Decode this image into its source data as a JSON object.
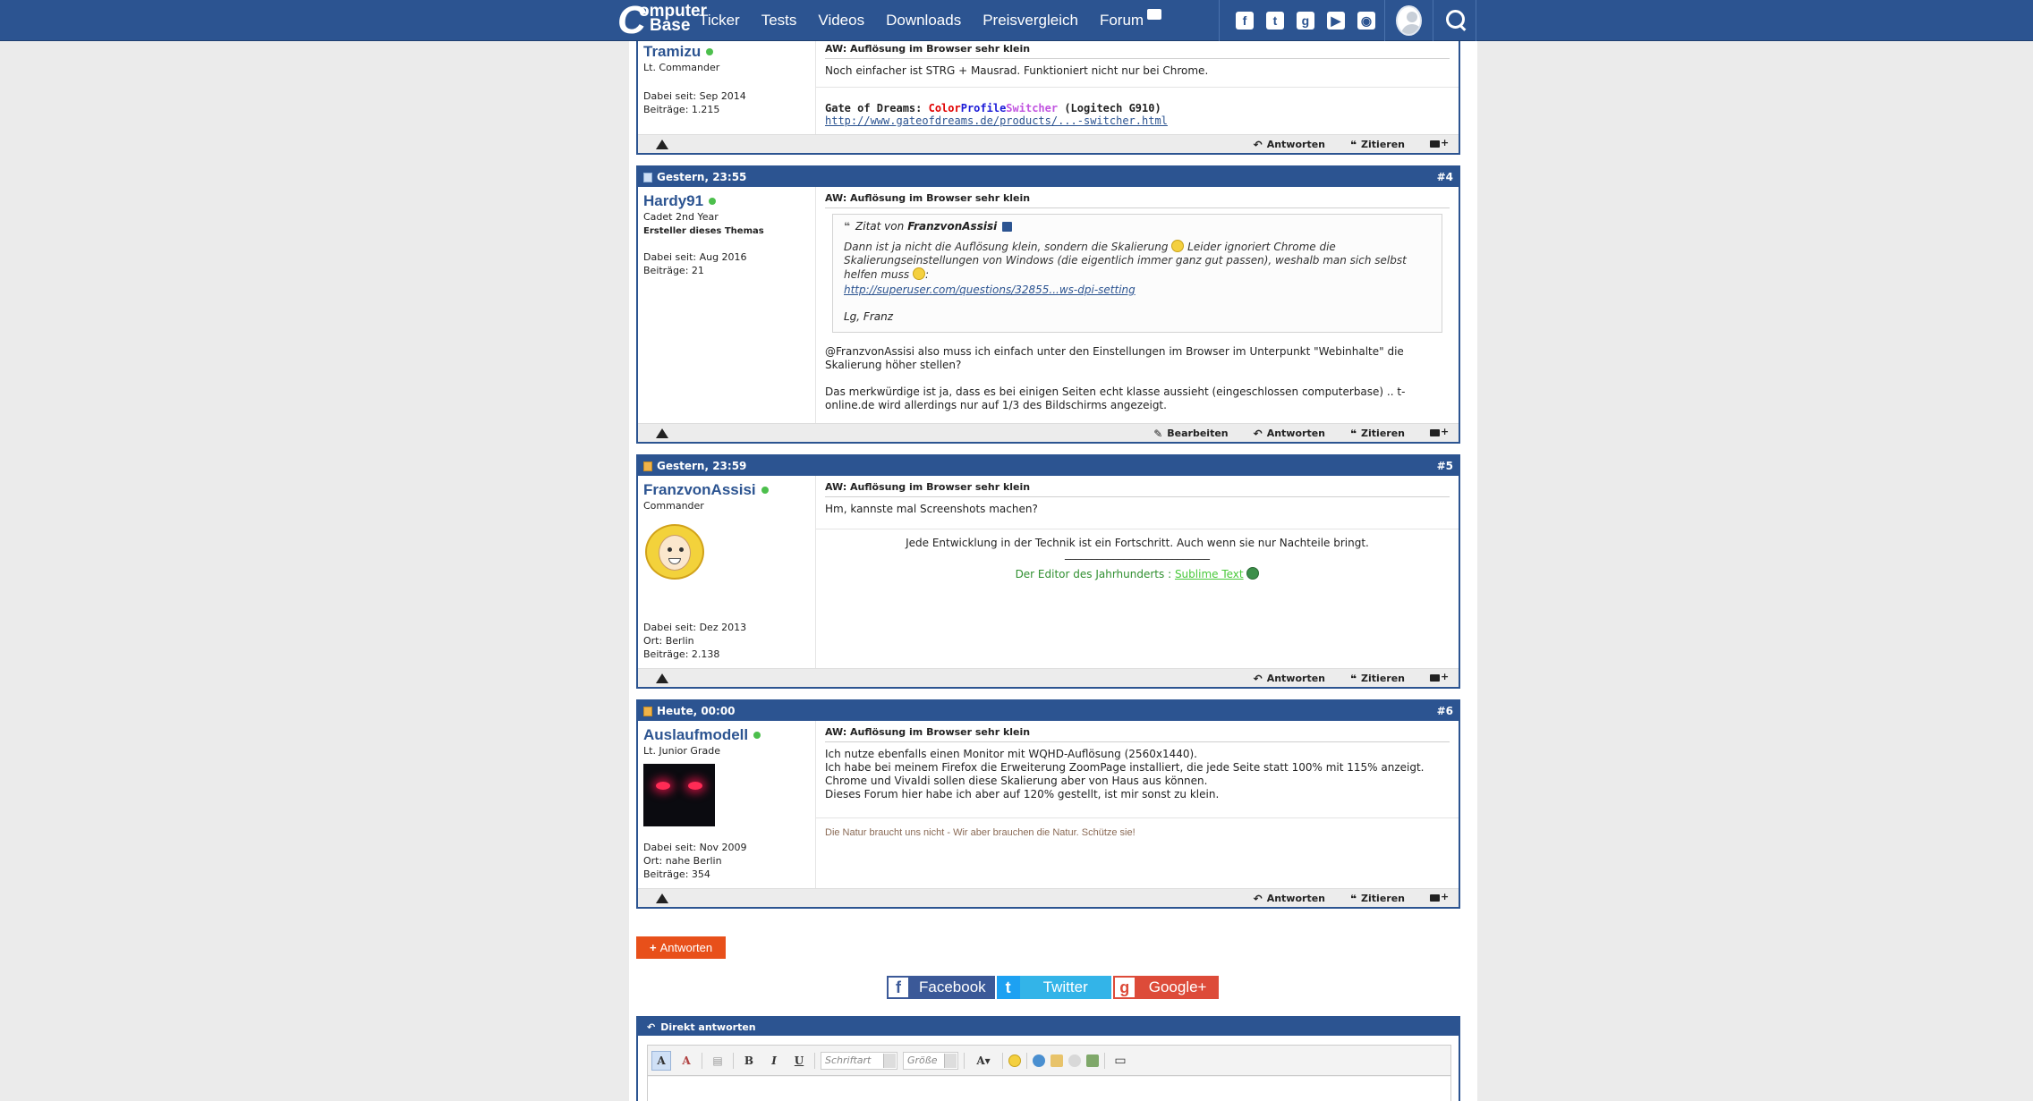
{
  "nav": {
    "logo_top": "omputer",
    "logo_c": "C",
    "logo_bottom": "Base",
    "links": [
      "Ticker",
      "Tests",
      "Videos",
      "Downloads",
      "Preisvergleich",
      "Forum"
    ],
    "social": [
      "facebook-icon",
      "twitter-icon",
      "googleplus-icon",
      "youtube-icon",
      "rss-icon"
    ]
  },
  "posts": [
    {
      "username": "Tramizu",
      "rank": "Lt. Commander",
      "joined": "Dabei seit: Sep 2014",
      "posts": "Beiträge: 1.215",
      "title": "AW: Auflösung im Browser sehr klein",
      "text": "Noch einfacher ist STRG + Mausrad. Funktioniert nicht nur bei Chrome.",
      "sig_prefix": "Gate of Dreams: ",
      "sig_color": "Color",
      "sig_profile": "Profile",
      "sig_switcher": "Switcher",
      "sig_suffix": " (Logitech G910)",
      "sig_link": "http://www.gateofdreams.de/products/...-switcher.html"
    },
    {
      "date": "Gestern, 23:55",
      "number": "#4",
      "username": "Hardy91",
      "rank": "Cadet 2nd Year",
      "creator": "Ersteller dieses Themas",
      "joined": "Dabei seit: Aug 2016",
      "posts": "Beiträge: 21",
      "title": "AW: Auflösung im Browser sehr klein",
      "quote_label": "Zitat von",
      "quote_author": "FranzvonAssisi",
      "quote_text_1": "Dann ist ja nicht die Auflösung klein, sondern die Skalierung",
      "quote_text_2": "Leider ignoriert Chrome die Skalierungseinstellungen von Windows (die eigentlich immer ganz gut passen), weshalb man sich selbst helfen muss",
      "quote_link": "http://superuser.com/questions/32855...ws-dpi-setting",
      "quote_sign": "Lg, Franz",
      "text_1": "@FranzvonAssisi also muss ich einfach unter den Einstellungen im Browser im Unterpunkt \"Webinhalte\" die Skalierung höher stellen?",
      "text_2": "Das merkwürdige ist ja, dass es bei einigen Seiten echt klasse aussieht (eingeschlossen computerbase) .. t-online.de wird allerdings nur auf 1/3 des Bildschirms angezeigt."
    },
    {
      "date": "Gestern, 23:59",
      "number": "#5",
      "username": "FranzvonAssisi",
      "rank": "Commander",
      "joined": "Dabei seit: Dez 2013",
      "location": "Ort: Berlin",
      "posts": "Beiträge: 2.138",
      "title": "AW: Auflösung im Browser sehr klein",
      "text": "Hm, kannste mal Screenshots machen?",
      "sig_line": "Jede Entwicklung in der Technik ist ein Fortschritt. Auch wenn sie nur Nachteile bringt.",
      "sig_rule": "___________________________",
      "sig_editor": "Der Editor des Jahrhunderts : ",
      "sig_editor_link": "Sublime Text"
    },
    {
      "date": "Heute, 00:00",
      "number": "#6",
      "username": "Auslaufmodell",
      "rank": "Lt. Junior Grade",
      "joined": "Dabei seit: Nov 2009",
      "location": "Ort: nahe Berlin",
      "posts": "Beiträge: 354",
      "title": "AW: Auflösung im Browser sehr klein",
      "lines": [
        "Ich nutze ebenfalls einen Monitor mit WQHD-Auflösung (2560x1440).",
        "Ich habe bei meinem Firefox die Erweiterung ZoomPage installiert, die jede Seite statt 100% mit 115% anzeigt.",
        "Chrome und Vivaldi sollen diese Skalierung aber von Haus aus können.",
        "Dieses Forum hier habe ich aber auf 120% gestellt, ist mir sonst zu klein."
      ],
      "sig": "Die Natur braucht uns nicht - Wir aber brauchen die Natur. Schütze sie!"
    }
  ],
  "footer_actions": {
    "edit": "Bearbeiten",
    "reply": "Antworten",
    "quote": "Zitieren"
  },
  "reply_button": "Antworten",
  "share": {
    "facebook": "Facebook",
    "twitter": "Twitter",
    "googleplus": "Google+"
  },
  "quick_reply": {
    "title": "Direkt antworten",
    "font_placeholder": "Schriftart",
    "size_placeholder": "Größe"
  },
  "colors": {
    "brand_blue": "#2c5491",
    "reply_orange": "#e8501a",
    "online_green": "#4cbf4c"
  }
}
